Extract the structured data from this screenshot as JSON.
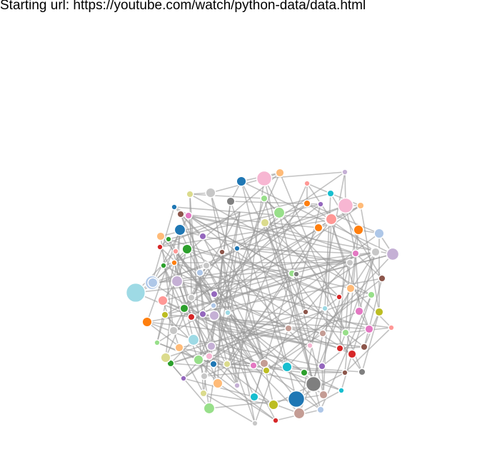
{
  "header": {
    "url_label": "Starting url: https://youtube.com/watch/python-data/data.html"
  },
  "graph": {
    "palette": [
      "#1f77b4",
      "#aec7e8",
      "#ff7f0e",
      "#ffbb78",
      "#2ca02c",
      "#98df8a",
      "#d62728",
      "#ff9896",
      "#9467bd",
      "#c5b0d5",
      "#8c564b",
      "#c49c94",
      "#e377c2",
      "#f7b6d2",
      "#7f7f7f",
      "#c7c7c7",
      "#bcbd22",
      "#dbdb8d",
      "#17becf",
      "#9edae5"
    ],
    "nodes": [
      {
        "color": "#aec7e8",
        "weight": 8
      },
      {
        "color": "#ffbb78",
        "weight": 4
      },
      {
        "color": "#f7b6d2",
        "weight": 9
      },
      {
        "color": "#1f77b4",
        "weight": 5
      },
      {
        "color": "#c5b0d5",
        "weight": 2
      },
      {
        "color": "#ff9896",
        "weight": 2
      },
      {
        "color": "#17becf",
        "weight": 3
      },
      {
        "color": "#c7c7c7",
        "weight": 5
      },
      {
        "color": "#dbdb8d",
        "weight": 3
      },
      {
        "color": "#7f7f7f",
        "weight": 4
      },
      {
        "color": "#98df8a",
        "weight": 3
      },
      {
        "color": "#f7b6d2",
        "weight": 9
      },
      {
        "color": "#ffbb78",
        "weight": 3
      },
      {
        "color": "#1f77b4",
        "weight": 2
      },
      {
        "color": "#ff7f0e",
        "weight": 3
      },
      {
        "color": "#9467bd",
        "weight": 2
      },
      {
        "color": "#98df8a",
        "weight": 6
      },
      {
        "color": "#ff9896",
        "weight": 6
      },
      {
        "color": "#ff7f0e",
        "weight": 5
      },
      {
        "color": "#aec7e8",
        "weight": 5
      },
      {
        "color": "#c5b0d5",
        "weight": 6
      },
      {
        "color": "#1f77b4",
        "weight": 6
      },
      {
        "color": "#9467bd",
        "weight": 3
      },
      {
        "color": "#2ca02c",
        "weight": 2
      },
      {
        "color": "#dbdb8d",
        "weight": 4
      },
      {
        "color": "#ff7f0e",
        "weight": 4
      },
      {
        "color": "#d62728",
        "weight": 2
      },
      {
        "color": "#2ca02c",
        "weight": 5
      },
      {
        "color": "#e377c2",
        "weight": 3
      },
      {
        "color": "#c7c7c7",
        "weight": 5
      },
      {
        "color": "#c5b0d5",
        "weight": 7
      },
      {
        "color": "#8c564b",
        "weight": 3
      },
      {
        "color": "#aec7e8",
        "weight": 5
      },
      {
        "color": "#c5b0d5",
        "weight": 6
      },
      {
        "color": "#9edae5",
        "weight": 12
      },
      {
        "color": "#ff9896",
        "weight": 5
      },
      {
        "color": "#bcbd22",
        "weight": 3
      },
      {
        "color": "#ff7f0e",
        "weight": 5
      },
      {
        "color": "#d62728",
        "weight": 2
      },
      {
        "color": "#c7c7c7",
        "weight": 4
      },
      {
        "color": "#98df8a",
        "weight": 2
      },
      {
        "color": "#9edae5",
        "weight": 6
      },
      {
        "color": "#c5b0d5",
        "weight": 4
      },
      {
        "color": "#ffbb78",
        "weight": 4
      },
      {
        "color": "#98df8a",
        "weight": 5
      },
      {
        "color": "#2ca02c",
        "weight": 3
      },
      {
        "color": "#9467bd",
        "weight": 2
      },
      {
        "color": "#dbdb8d",
        "weight": 3
      },
      {
        "color": "#ffbb78",
        "weight": 5
      },
      {
        "color": "#98df8a",
        "weight": 6
      },
      {
        "color": "#17becf",
        "weight": 4
      },
      {
        "color": "#bcbd22",
        "weight": 5
      },
      {
        "color": "#d62728",
        "weight": 2
      },
      {
        "color": "#1f77b4",
        "weight": 10
      },
      {
        "color": "#c49c94",
        "weight": 6
      },
      {
        "color": "#7f7f7f",
        "weight": 9
      },
      {
        "color": "#aec7e8",
        "weight": 3
      },
      {
        "color": "#c49c94",
        "weight": 4
      },
      {
        "color": "#17becf",
        "weight": 2
      },
      {
        "color": "#2ca02c",
        "weight": 3
      },
      {
        "color": "#17becf",
        "weight": 5
      },
      {
        "color": "#9467bd",
        "weight": 3
      },
      {
        "color": "#d62728",
        "weight": 4
      },
      {
        "color": "#8c564b",
        "weight": 2
      },
      {
        "color": "#7f7f7f",
        "weight": 3
      },
      {
        "color": "#e377c2",
        "weight": 4
      },
      {
        "color": "#98df8a",
        "weight": 3
      },
      {
        "color": "#ff9896",
        "weight": 2
      },
      {
        "color": "#bcbd22",
        "weight": 4
      },
      {
        "color": "#e377c2",
        "weight": 4
      },
      {
        "color": "#ffbb78",
        "weight": 4
      },
      {
        "color": "#98df8a",
        "weight": 3
      },
      {
        "color": "#8c564b",
        "weight": 3
      },
      {
        "color": "#c7c7c7",
        "weight": 4
      },
      {
        "color": "#e377c2",
        "weight": 3
      },
      {
        "color": "#9edae5",
        "weight": 2
      },
      {
        "color": "#d62728",
        "weight": 3
      },
      {
        "color": "#c49c94",
        "weight": 3
      },
      {
        "color": "#8c564b",
        "weight": 2
      },
      {
        "color": "#f7b6d2",
        "weight": 2
      },
      {
        "color": "#c5b0d5",
        "weight": 5
      },
      {
        "color": "#9467bd",
        "weight": 3
      },
      {
        "color": "#dbdb8d",
        "weight": 5
      },
      {
        "color": "#2ca02c",
        "weight": 4
      },
      {
        "color": "#d62728",
        "weight": 3
      },
      {
        "color": "#aec7e8",
        "weight": 3
      },
      {
        "color": "#c7c7c7",
        "weight": 3
      },
      {
        "color": "#8c564b",
        "weight": 2
      },
      {
        "color": "#ff9896",
        "weight": 6
      },
      {
        "color": "#c49c94",
        "weight": 4
      },
      {
        "color": "#bcbd22",
        "weight": 3
      },
      {
        "color": "#c5b0d5",
        "weight": 2
      },
      {
        "color": "#dbdb8d",
        "weight": 3
      },
      {
        "color": "#1f77b4",
        "weight": 3
      },
      {
        "color": "#c7c7c7",
        "weight": 3
      },
      {
        "color": "#9467bd",
        "weight": 3
      },
      {
        "color": "#f7b6d2",
        "weight": 3
      },
      {
        "color": "#e377c2",
        "weight": 3
      },
      {
        "color": "#2ca02c",
        "weight": 2
      },
      {
        "color": "#ffbb78",
        "weight": 4
      },
      {
        "color": "#ff7f0e",
        "weight": 2
      },
      {
        "color": "#98df8a",
        "weight": 3
      },
      {
        "color": "#c49c94",
        "weight": 3
      },
      {
        "color": "#d62728",
        "weight": 2
      },
      {
        "color": "#c7c7c7",
        "weight": 3
      },
      {
        "color": "#7f7f7f",
        "weight": 2
      },
      {
        "color": "#c7c7c7",
        "weight": 2
      },
      {
        "color": "#e377c2",
        "weight": 3
      },
      {
        "color": "#1f77b4",
        "weight": 2
      },
      {
        "color": "#aec7e8",
        "weight": 2
      },
      {
        "color": "#8c564b",
        "weight": 3
      },
      {
        "color": "#ff9896",
        "weight": 2
      },
      {
        "color": "#9edae5",
        "weight": 2
      },
      {
        "color": "#c7c7c7",
        "weight": 3
      }
    ],
    "edges": [
      [
        0,
        1
      ],
      [
        0,
        13
      ],
      [
        0,
        20
      ],
      [
        1,
        2
      ],
      [
        1,
        3
      ],
      [
        2,
        4
      ],
      [
        2,
        7
      ],
      [
        3,
        9
      ],
      [
        4,
        11
      ],
      [
        5,
        6
      ],
      [
        5,
        14
      ],
      [
        6,
        12
      ],
      [
        7,
        8
      ],
      [
        8,
        10
      ],
      [
        9,
        15
      ],
      [
        10,
        16
      ],
      [
        11,
        12
      ],
      [
        11,
        18
      ],
      [
        12,
        17
      ],
      [
        13,
        22
      ],
      [
        14,
        19
      ],
      [
        15,
        23
      ],
      [
        16,
        24
      ],
      [
        17,
        25
      ],
      [
        18,
        19
      ],
      [
        19,
        30
      ],
      [
        20,
        21
      ],
      [
        20,
        27
      ],
      [
        21,
        22
      ],
      [
        23,
        26
      ],
      [
        24,
        28
      ],
      [
        25,
        29
      ],
      [
        26,
        33
      ],
      [
        27,
        32
      ],
      [
        28,
        31
      ],
      [
        29,
        35
      ],
      [
        30,
        36
      ],
      [
        31,
        37
      ],
      [
        32,
        34
      ],
      [
        33,
        35
      ],
      [
        34,
        38
      ],
      [
        35,
        39
      ],
      [
        36,
        40
      ],
      [
        37,
        41
      ],
      [
        38,
        42
      ],
      [
        39,
        43
      ],
      [
        40,
        44
      ],
      [
        41,
        45
      ],
      [
        42,
        46
      ],
      [
        43,
        47
      ],
      [
        44,
        48
      ],
      [
        45,
        49
      ],
      [
        46,
        50
      ],
      [
        47,
        51
      ],
      [
        48,
        52
      ],
      [
        49,
        53
      ],
      [
        50,
        54
      ],
      [
        51,
        55
      ],
      [
        52,
        56
      ],
      [
        53,
        57
      ],
      [
        54,
        58
      ],
      [
        55,
        59
      ],
      [
        56,
        60
      ],
      [
        57,
        61
      ],
      [
        58,
        62
      ],
      [
        59,
        63
      ],
      [
        60,
        64
      ],
      [
        61,
        65
      ],
      [
        62,
        66
      ],
      [
        63,
        67
      ],
      [
        64,
        68
      ],
      [
        65,
        69
      ],
      [
        66,
        70
      ],
      [
        67,
        71
      ],
      [
        68,
        72
      ],
      [
        69,
        73
      ],
      [
        70,
        74
      ],
      [
        71,
        75
      ],
      [
        72,
        76
      ],
      [
        73,
        77
      ],
      [
        74,
        78
      ],
      [
        75,
        79
      ],
      [
        76,
        80
      ],
      [
        77,
        81
      ],
      [
        78,
        82
      ],
      [
        79,
        83
      ],
      [
        80,
        84
      ],
      [
        81,
        85
      ],
      [
        82,
        86
      ],
      [
        83,
        87
      ],
      [
        84,
        88
      ],
      [
        85,
        89
      ],
      [
        86,
        90
      ],
      [
        87,
        91
      ],
      [
        88,
        92
      ],
      [
        89,
        93
      ],
      [
        90,
        94
      ],
      [
        91,
        95
      ],
      [
        92,
        96
      ],
      [
        93,
        97
      ],
      [
        94,
        98
      ],
      [
        95,
        99
      ],
      [
        96,
        100
      ],
      [
        97,
        101
      ],
      [
        98,
        102
      ],
      [
        99,
        103
      ],
      [
        100,
        104
      ],
      [
        101,
        105
      ],
      [
        102,
        106
      ],
      [
        103,
        107
      ],
      [
        104,
        108
      ],
      [
        105,
        109
      ],
      [
        106,
        110
      ],
      [
        107,
        111
      ],
      [
        108,
        112
      ],
      [
        109,
        113
      ],
      [
        110,
        114
      ],
      [
        111,
        115
      ],
      [
        112,
        116
      ],
      [
        113,
        117
      ],
      [
        0,
        57
      ],
      [
        1,
        64
      ],
      [
        2,
        71
      ],
      [
        3,
        78
      ],
      [
        4,
        85
      ],
      [
        5,
        92
      ],
      [
        6,
        99
      ],
      [
        7,
        106
      ],
      [
        8,
        113
      ],
      [
        9,
        60
      ],
      [
        10,
        67
      ],
      [
        11,
        74
      ],
      [
        12,
        81
      ],
      [
        13,
        88
      ],
      [
        14,
        95
      ],
      [
        15,
        102
      ],
      [
        16,
        109
      ],
      [
        17,
        116
      ],
      [
        18,
        61
      ],
      [
        19,
        68
      ],
      [
        20,
        75
      ],
      [
        21,
        82
      ],
      [
        22,
        89
      ],
      [
        23,
        96
      ],
      [
        24,
        103
      ],
      [
        25,
        110
      ],
      [
        26,
        117
      ],
      [
        27,
        62
      ],
      [
        28,
        69
      ],
      [
        29,
        76
      ],
      [
        30,
        83
      ],
      [
        31,
        90
      ],
      [
        32,
        97
      ],
      [
        33,
        104
      ],
      [
        34,
        111
      ],
      [
        35,
        58
      ],
      [
        36,
        65
      ],
      [
        37,
        72
      ],
      [
        38,
        79
      ],
      [
        39,
        86
      ],
      [
        40,
        93
      ],
      [
        41,
        100
      ],
      [
        42,
        107
      ],
      [
        43,
        114
      ],
      [
        44,
        59
      ],
      [
        45,
        66
      ],
      [
        46,
        73
      ],
      [
        47,
        80
      ],
      [
        48,
        87
      ],
      [
        49,
        94
      ],
      [
        50,
        101
      ],
      [
        51,
        108
      ],
      [
        52,
        115
      ],
      [
        53,
        63
      ],
      [
        54,
        70
      ],
      [
        55,
        77
      ],
      [
        56,
        84
      ],
      [
        2,
        91
      ],
      [
        11,
        98
      ],
      [
        34,
        105
      ],
      [
        53,
        112
      ],
      [
        55,
        44
      ],
      [
        21,
        50
      ],
      [
        30,
        60
      ],
      [
        5,
        88
      ],
      [
        9,
        42
      ],
      [
        17,
        26
      ],
      [
        24,
        55
      ],
      [
        33,
        48
      ],
      [
        40,
        81
      ],
      [
        6,
        31
      ],
      [
        12,
        36
      ],
      [
        19,
        46
      ],
      [
        27,
        70
      ],
      [
        29,
        95
      ],
      [
        3,
        53
      ],
      [
        11,
        34
      ],
      [
        2,
        55
      ],
      [
        20,
        62
      ],
      [
        15,
        83
      ],
      [
        16,
        57
      ],
      [
        38,
        71
      ],
      [
        22,
        104
      ],
      [
        8,
        66
      ],
      [
        45,
        90
      ],
      [
        28,
        110
      ],
      [
        37,
        52
      ],
      [
        13,
        101
      ],
      [
        4,
        54
      ],
      [
        10,
        93
      ],
      [
        25,
        48
      ],
      [
        32,
        73
      ],
      [
        39,
        99
      ],
      [
        14,
        85
      ],
      [
        41,
        61
      ],
      [
        47,
        106
      ],
      [
        1,
        44
      ],
      [
        7,
        89
      ],
      [
        18,
        63
      ],
      [
        23,
        114
      ],
      [
        35,
        115
      ],
      [
        43,
        102
      ],
      [
        49,
        117
      ],
      [
        51,
        96
      ],
      [
        59,
        112
      ],
      [
        65,
        100
      ],
      [
        67,
        109
      ],
      [
        72,
        97
      ],
      [
        76,
        116
      ],
      [
        78,
        105
      ],
      [
        84,
        111
      ],
      [
        87,
        103
      ],
      [
        91,
        113
      ],
      [
        0,
        86
      ],
      [
        6,
        75
      ],
      [
        9,
        80
      ],
      [
        12,
        68
      ],
      [
        26,
        60
      ],
      [
        30,
        97
      ],
      [
        36,
        91
      ],
      [
        42,
        58
      ],
      [
        46,
        82
      ],
      [
        50,
        89
      ],
      [
        54,
        107
      ],
      [
        56,
        66
      ],
      [
        64,
        101
      ],
      [
        69,
        94
      ],
      [
        74,
        108
      ],
      [
        77,
        90
      ],
      [
        79,
        115
      ],
      [
        83,
        98
      ],
      [
        92,
        109
      ],
      [
        94,
        117
      ],
      [
        3,
        30
      ],
      [
        8,
        47
      ],
      [
        10,
        56
      ],
      [
        14,
        29
      ],
      [
        17,
        65
      ],
      [
        21,
        37
      ],
      [
        24,
        79
      ],
      [
        31,
        72
      ],
      [
        33,
        84
      ],
      [
        40,
        100
      ],
      [
        45,
        102
      ],
      [
        57,
        88
      ],
      [
        61,
        110
      ],
      [
        63,
        92
      ],
      [
        71,
        104
      ]
    ]
  }
}
